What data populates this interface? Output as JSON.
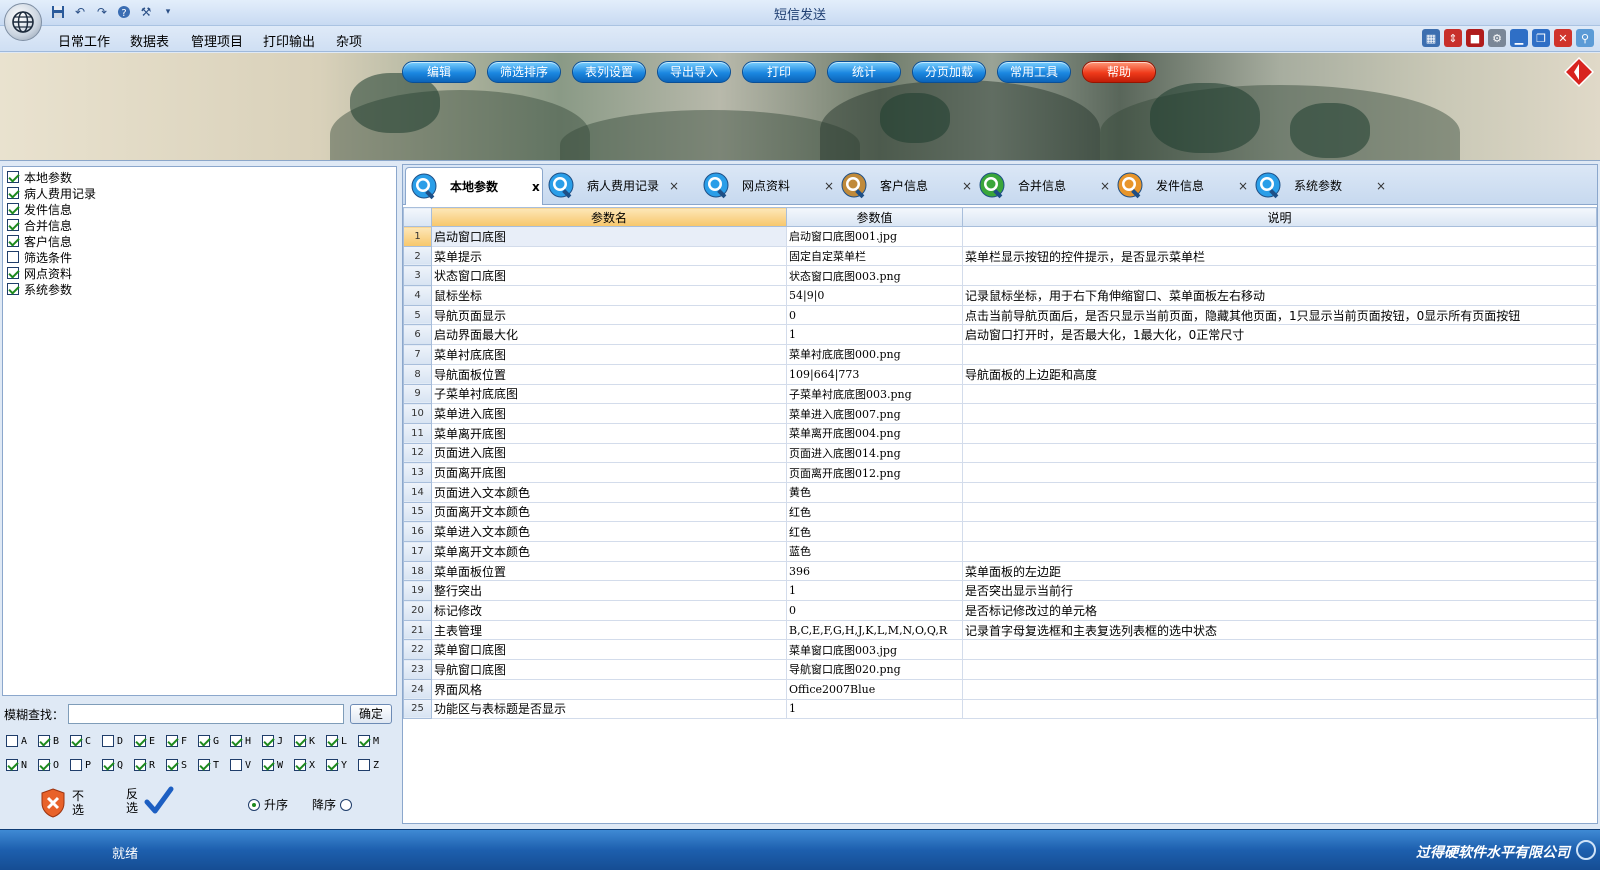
{
  "window": {
    "title": "短信发送"
  },
  "quick_access": [
    "save-icon",
    "undo-icon",
    "redo-icon",
    "help-icon",
    "tools-icon",
    "dropdown-icon"
  ],
  "menu": [
    "日常工作",
    "数据表",
    "管理项目",
    "打印输出",
    "杂项"
  ],
  "nav_buttons": [
    "编辑",
    "筛选排序",
    "表列设置",
    "导出导入",
    "打印",
    "统计",
    "分页加载",
    "常用工具",
    "帮助"
  ],
  "left": {
    "checklist": [
      {
        "label": "本地参数",
        "checked": true
      },
      {
        "label": "病人费用记录",
        "checked": true
      },
      {
        "label": "发件信息",
        "checked": true
      },
      {
        "label": "合并信息",
        "checked": true
      },
      {
        "label": "客户信息",
        "checked": true
      },
      {
        "label": "筛选条件",
        "checked": false
      },
      {
        "label": "网点资料",
        "checked": true
      },
      {
        "label": "系统参数",
        "checked": true
      }
    ],
    "search_label": "模糊查找：",
    "search_value": "",
    "confirm_label": "确定",
    "letters_row1": [
      {
        "l": "A",
        "c": false
      },
      {
        "l": "B",
        "c": true
      },
      {
        "l": "C",
        "c": true
      },
      {
        "l": "D",
        "c": false
      },
      {
        "l": "E",
        "c": true
      },
      {
        "l": "F",
        "c": true
      },
      {
        "l": "G",
        "c": true
      },
      {
        "l": "H",
        "c": true
      },
      {
        "l": "J",
        "c": true
      },
      {
        "l": "K",
        "c": true
      },
      {
        "l": "L",
        "c": true
      },
      {
        "l": "M",
        "c": true
      }
    ],
    "letters_row2": [
      {
        "l": "N",
        "c": true
      },
      {
        "l": "O",
        "c": true
      },
      {
        "l": "P",
        "c": false
      },
      {
        "l": "Q",
        "c": true
      },
      {
        "l": "R",
        "c": true
      },
      {
        "l": "S",
        "c": true
      },
      {
        "l": "T",
        "c": true
      },
      {
        "l": "V",
        "c": false
      },
      {
        "l": "W",
        "c": true
      },
      {
        "l": "X",
        "c": true
      },
      {
        "l": "Y",
        "c": true
      },
      {
        "l": "Z",
        "c": false
      }
    ],
    "none_label": "不选",
    "invert_label": "反选",
    "asc_label": "升序",
    "desc_label": "降序",
    "sort": "asc"
  },
  "tabs": [
    {
      "label": "本地参数",
      "active": true,
      "color": "#2a9ee8"
    },
    {
      "label": "病人费用记录",
      "active": false,
      "color": "#2a9ee8"
    },
    {
      "label": "网点资料",
      "active": false,
      "color": "#2a9ee8"
    },
    {
      "label": "客户信息",
      "active": false,
      "color": "#c08a3a"
    },
    {
      "label": "合并信息",
      "active": false,
      "color": "#3aa63a"
    },
    {
      "label": "发件信息",
      "active": false,
      "color": "#e8952a"
    },
    {
      "label": "系统参数",
      "active": false,
      "color": "#2a9ee8"
    }
  ],
  "tab_close_active": "x",
  "tab_close": "×",
  "grid": {
    "headers": [
      "参数名",
      "参数值",
      "说明"
    ],
    "rows": [
      [
        "启动窗口底图",
        "启动窗口底图001.jpg",
        ""
      ],
      [
        "菜单提示",
        "固定自定菜单栏",
        "菜单栏显示按钮的控件提示，是否显示菜单栏"
      ],
      [
        "状态窗口底图",
        "状态窗口底图003.png",
        ""
      ],
      [
        "鼠标坐标",
        "54|9|0",
        "记录鼠标坐标，用于右下角伸缩窗口、菜单面板左右移动"
      ],
      [
        "导航页面显示",
        "0",
        "点击当前导航页面后，是否只显示当前页面，隐藏其他页面，1只显示当前页面按钮，0显示所有页面按钮"
      ],
      [
        "启动界面最大化",
        "1",
        "启动窗口打开时，是否最大化，1最大化，0正常尺寸"
      ],
      [
        "菜单衬底底图",
        "菜单衬底底图000.png",
        ""
      ],
      [
        "导航面板位置",
        "109|664|773",
        "导航面板的上边距和高度"
      ],
      [
        "子菜单衬底底图",
        "子菜单衬底底图003.png",
        ""
      ],
      [
        "菜单进入底图",
        "菜单进入底图007.png",
        ""
      ],
      [
        "菜单离开底图",
        "菜单离开底图004.png",
        ""
      ],
      [
        "页面进入底图",
        "页面进入底图014.png",
        ""
      ],
      [
        "页面离开底图",
        "页面离开底图012.png",
        ""
      ],
      [
        "页面进入文本颜色",
        "黄色",
        ""
      ],
      [
        "页面离开文本颜色",
        "红色",
        ""
      ],
      [
        "菜单进入文本颜色",
        "红色",
        ""
      ],
      [
        "菜单离开文本颜色",
        "蓝色",
        ""
      ],
      [
        "菜单面板位置",
        "396",
        "菜单面板的左边距"
      ],
      [
        "整行突出",
        "1",
        "是否突出显示当前行"
      ],
      [
        "标记修改",
        "0",
        "是否标记修改过的单元格"
      ],
      [
        "主表管理",
        "B,C,E,F,G,H,J,K,L,M,N,O,Q,R",
        "记录首字母复选框和主表复选列表框的选中状态"
      ],
      [
        "菜单窗口底图",
        "菜单窗口底图003.jpg",
        ""
      ],
      [
        "导航窗口底图",
        "导航窗口底图020.png",
        ""
      ],
      [
        "界面风格",
        "Office2007Blue",
        ""
      ],
      [
        "功能区与表标题是否显示",
        "1",
        ""
      ]
    ]
  },
  "status": {
    "text": "就绪",
    "company": "过得硬软件水平有限公司"
  },
  "colors": {
    "accent": "#1b87e0",
    "statusbar": "#1d5fae",
    "help": "#ef3a1a"
  }
}
